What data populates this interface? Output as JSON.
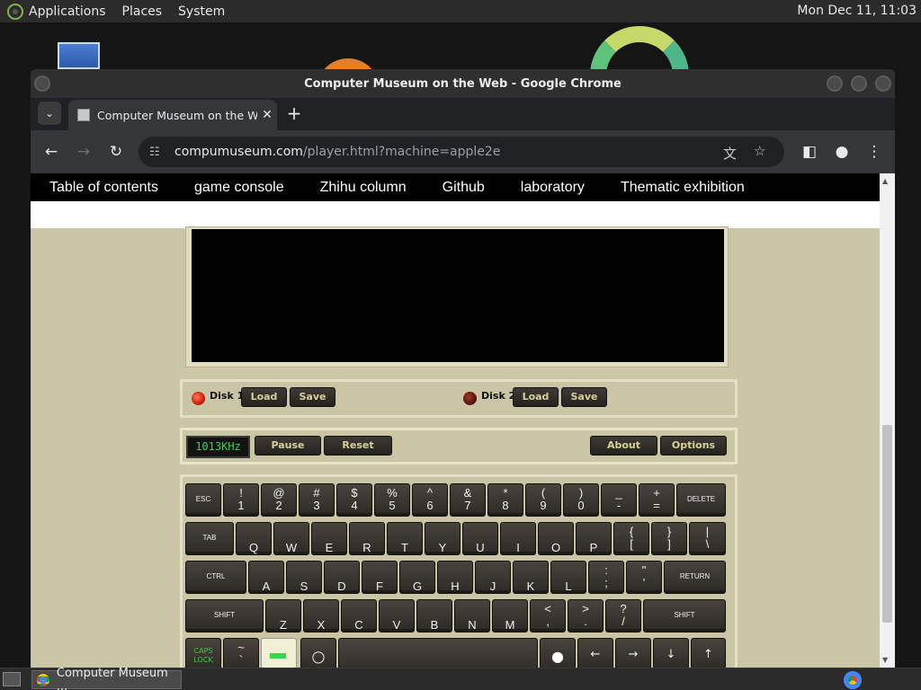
{
  "top_panel": {
    "menus": [
      "Applications",
      "Places",
      "System"
    ],
    "clock": "Mon Dec 11, 11:03"
  },
  "window": {
    "title": "Computer Museum on the Web - Google Chrome"
  },
  "browser": {
    "tab_title": "Computer Museum on the W",
    "url_host": "compumuseum.com",
    "url_path": "/player.html?machine=apple2e"
  },
  "site_nav": [
    "Table of contents",
    "game console",
    "Zhihu column",
    "Github",
    "laboratory",
    "Thematic exhibition"
  ],
  "emulator": {
    "disk1": {
      "label": "Disk 1",
      "load": "Load",
      "save": "Save"
    },
    "disk2": {
      "label": "Disk 2",
      "load": "Load",
      "save": "Save"
    },
    "speed": "1013KHz",
    "pause": "Pause",
    "reset": "Reset",
    "about": "About",
    "options": "Options"
  },
  "keyboard": {
    "row1": [
      {
        "s": "ESC"
      },
      {
        "t": "!",
        "b": "1"
      },
      {
        "t": "@",
        "b": "2"
      },
      {
        "t": "#",
        "b": "3"
      },
      {
        "t": "$",
        "b": "4"
      },
      {
        "t": "%",
        "b": "5"
      },
      {
        "t": "^",
        "b": "6"
      },
      {
        "t": "&",
        "b": "7"
      },
      {
        "t": "*",
        "b": "8"
      },
      {
        "t": "(",
        "b": "9"
      },
      {
        "t": ")",
        "b": "0"
      },
      {
        "t": "_",
        "b": "-"
      },
      {
        "t": "+",
        "b": "="
      },
      {
        "s": "DELETE"
      }
    ],
    "row2": [
      {
        "s": "TAB"
      },
      {
        "c": "Q"
      },
      {
        "c": "W"
      },
      {
        "c": "E"
      },
      {
        "c": "R"
      },
      {
        "c": "T"
      },
      {
        "c": "Y"
      },
      {
        "c": "U"
      },
      {
        "c": "I"
      },
      {
        "c": "O"
      },
      {
        "c": "P"
      },
      {
        "t": "{",
        "b": "["
      },
      {
        "t": "}",
        "b": "]"
      },
      {
        "t": "|",
        "b": "\\"
      }
    ],
    "row3": [
      {
        "s": "CTRL"
      },
      {
        "c": "A"
      },
      {
        "c": "S"
      },
      {
        "c": "D"
      },
      {
        "c": "F"
      },
      {
        "c": "G"
      },
      {
        "c": "H"
      },
      {
        "c": "J"
      },
      {
        "c": "K"
      },
      {
        "c": "L"
      },
      {
        "t": ":",
        "b": ";"
      },
      {
        "t": "\"",
        "b": "'"
      },
      {
        "s": "RETURN"
      }
    ],
    "row4": [
      {
        "s": "SHIFT"
      },
      {
        "c": "Z"
      },
      {
        "c": "X"
      },
      {
        "c": "C"
      },
      {
        "c": "V"
      },
      {
        "c": "B"
      },
      {
        "c": "N"
      },
      {
        "c": "M"
      },
      {
        "t": "<",
        "b": ","
      },
      {
        "t": ">",
        "b": "."
      },
      {
        "t": "?",
        "b": "/"
      },
      {
        "s": "SHIFT"
      }
    ],
    "row5": [
      {
        "caps": [
          "CAPS",
          "LOCK"
        ]
      },
      {
        "t": "~",
        "b": "`"
      },
      {
        "power": true
      },
      {
        "glyph": "open-apple-icon"
      },
      {
        "space": true
      },
      {
        "glyph": "closed-apple-icon"
      },
      {
        "arrow": "←"
      },
      {
        "arrow": "→"
      },
      {
        "arrow": "↓"
      },
      {
        "arrow": "↑"
      }
    ]
  },
  "taskbar": {
    "task_label": "Computer Museum ..."
  }
}
